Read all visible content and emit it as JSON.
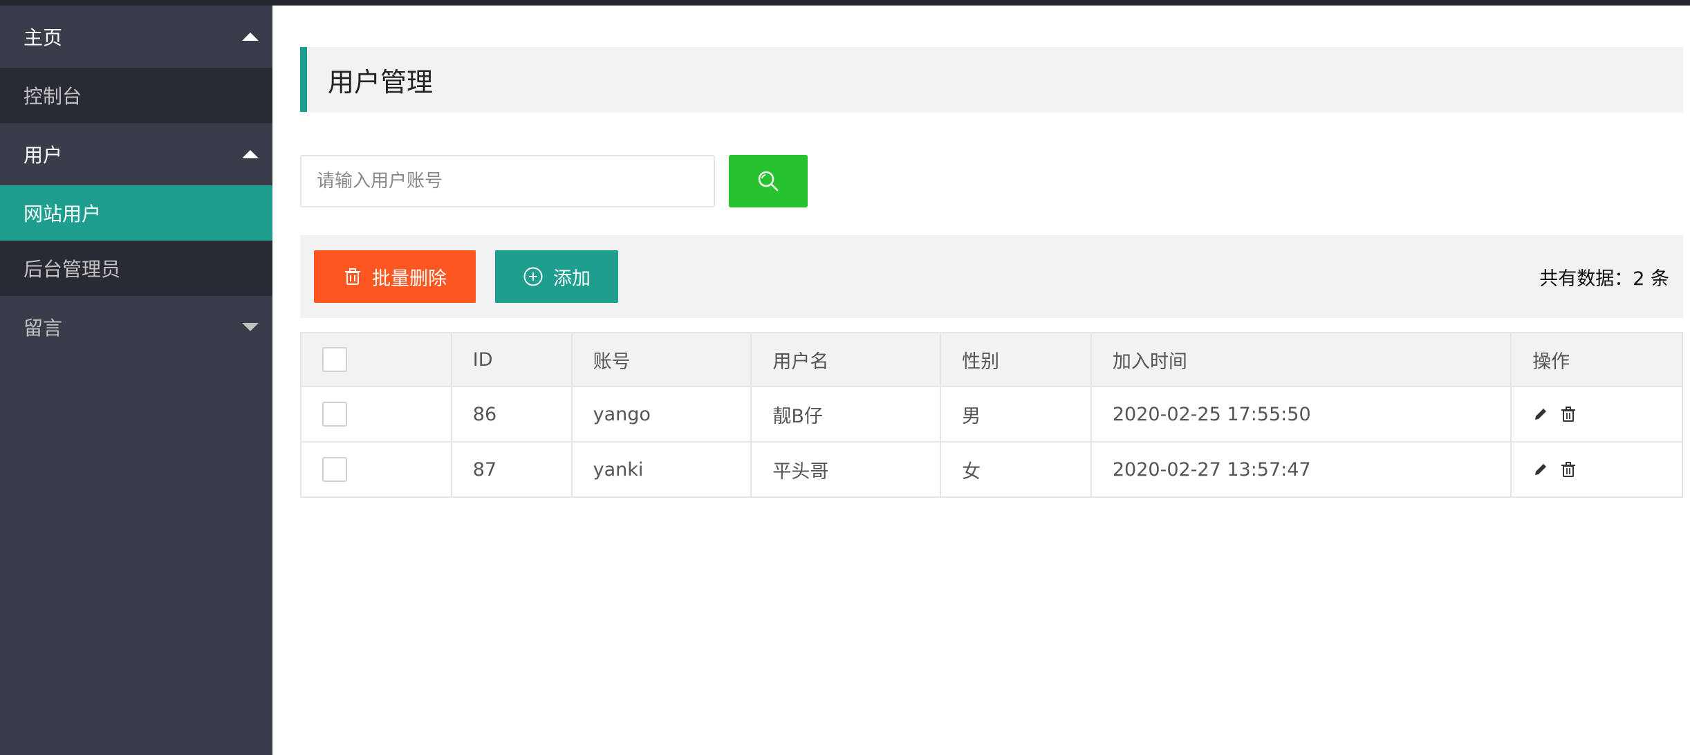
{
  "sidebar": {
    "groups": [
      {
        "label": "主页",
        "expanded": true,
        "children": [
          "控制台"
        ]
      },
      {
        "label": "用户",
        "expanded": true,
        "children": [
          "网站用户",
          "后台管理员"
        ]
      },
      {
        "label": "留言",
        "expanded": false,
        "children": []
      }
    ],
    "active_item": "网站用户"
  },
  "page": {
    "title": "用户管理"
  },
  "search": {
    "placeholder": "请输入用户账号",
    "value": "",
    "button_icon": "search-icon"
  },
  "toolbar": {
    "batch_delete_label": "批量删除",
    "add_label": "添加",
    "total_text": "共有数据：2 条"
  },
  "table": {
    "columns": [
      "ID",
      "账号",
      "用户名",
      "性别",
      "加入时间",
      "操作"
    ],
    "rows": [
      {
        "id": "86",
        "account": "yango",
        "username": "靓B仔",
        "gender": "男",
        "joined": "2020-02-25 17:55:50"
      },
      {
        "id": "87",
        "account": "yanki",
        "username": "平头哥",
        "gender": "女",
        "joined": "2020-02-27 13:57:47"
      }
    ]
  },
  "colors": {
    "accent": "#1e9e8f",
    "danger": "#ff5722",
    "search": "#27c22d",
    "sidebar": "#393d49"
  }
}
